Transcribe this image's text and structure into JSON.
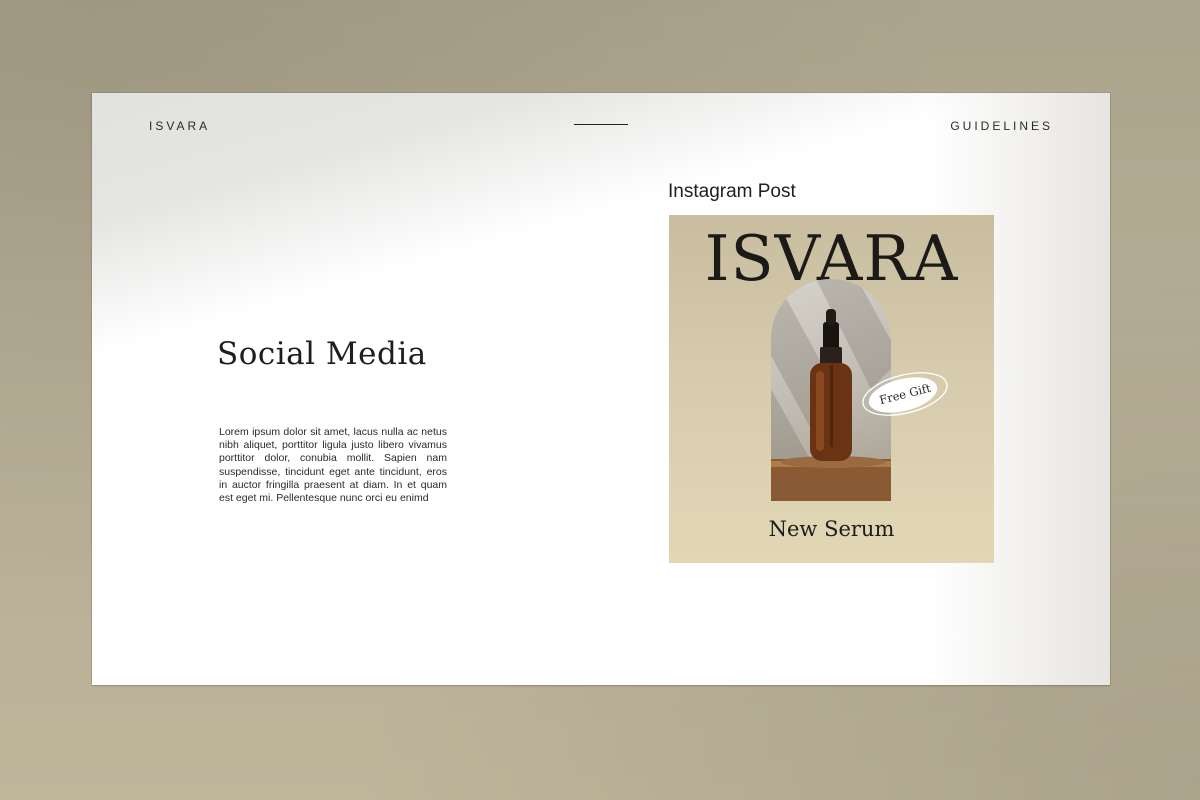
{
  "header": {
    "brand": "ISVARA",
    "section": "GUIDELINES"
  },
  "slide": {
    "title": "Social Media",
    "body": "Lorem ipsum dolor sit amet, lacus nulla ac netus nibh aliquet, porttitor ligula justo libero vivamus porttitor dolor, conubia mollit. Sapien nam suspendisse, tincidunt eget ante tincidunt, eros in auctor fringilla praesent at diam. In et quam est eget mi. Pellentesque nunc orci eu enimd"
  },
  "instagram_post": {
    "label": "Instagram Post",
    "brand": "ISVARA",
    "badge": "Free Gift",
    "product": "New Serum"
  },
  "colors": {
    "backdrop": "#b6ad95",
    "post_background": "#d6cbac",
    "bottle_amber": "#6a3414",
    "text_dark": "#1e1e1e"
  },
  "icons": {
    "product_image": "serum-bottle-image",
    "badge_shape": "ellipse-badge"
  }
}
